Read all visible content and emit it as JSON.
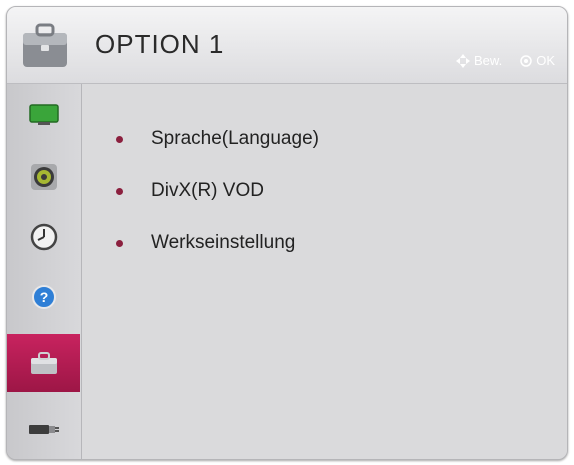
{
  "header": {
    "title": "OPTION 1",
    "hints": [
      {
        "icon": "navigate-arrows-icon",
        "label": "Bew."
      },
      {
        "icon": "ok-button-icon",
        "label": "OK"
      }
    ]
  },
  "sidebar": {
    "items": [
      {
        "name": "picture",
        "icon": "tv-screen-icon",
        "active": false
      },
      {
        "name": "audio",
        "icon": "speaker-icon",
        "active": false
      },
      {
        "name": "time",
        "icon": "clock-icon",
        "active": false
      },
      {
        "name": "support",
        "icon": "help-icon",
        "active": false
      },
      {
        "name": "option",
        "icon": "toolbox-icon",
        "active": true
      },
      {
        "name": "connection",
        "icon": "plug-icon",
        "active": false
      }
    ]
  },
  "menu": {
    "items": [
      {
        "label": "Sprache(Language)"
      },
      {
        "label": "DivX(R) VOD"
      },
      {
        "label": "Werkseinstellung"
      }
    ]
  },
  "colors": {
    "active_highlight": "#b01c50",
    "bullet": "#8b1f3e",
    "panel_bg": "#dadadc"
  }
}
